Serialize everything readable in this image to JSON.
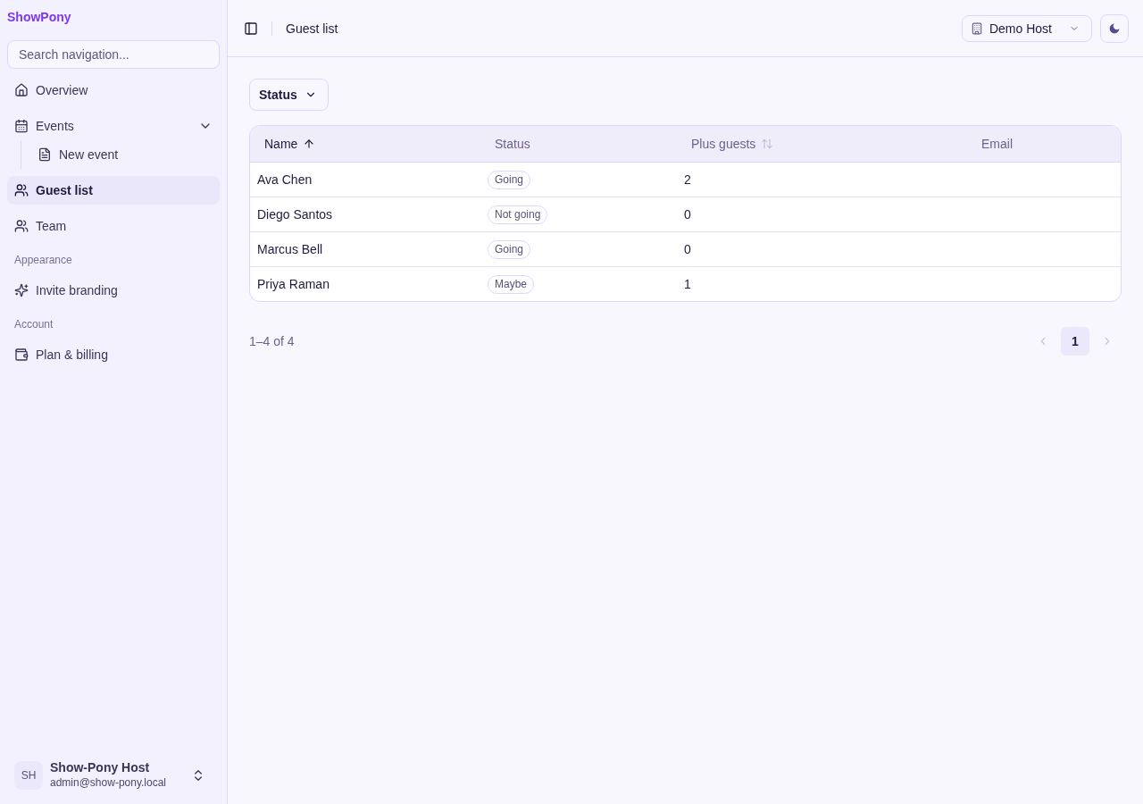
{
  "sidebar": {
    "brand": "ShowPony",
    "search": {
      "placeholder": "Search navigation..."
    },
    "groups": [
      {
        "items": [
          {
            "label": "Overview",
            "selected": false
          },
          {
            "label": "Events",
            "selected": false,
            "expanded": true,
            "children": [
              {
                "label": "New event",
                "selected": false
              }
            ]
          },
          {
            "label": "Guest list",
            "selected": true
          },
          {
            "label": "Team",
            "selected": false
          }
        ]
      },
      {
        "heading": "Appearance",
        "items": [
          {
            "label": "Invite branding",
            "selected": false
          }
        ]
      },
      {
        "heading": "Account",
        "items": [
          {
            "label": "Plan & billing",
            "selected": false
          }
        ]
      }
    ],
    "user": {
      "initials": "SH",
      "name": "Show-Pony Host",
      "email": "admin@show-pony.local"
    }
  },
  "header": {
    "title": "Guest list",
    "workspace": "Demo Host"
  },
  "filters": [
    {
      "label": "Status"
    }
  ],
  "table": {
    "columns": [
      {
        "label": "Name",
        "sortable": true,
        "sorted": true
      },
      {
        "label": "Status",
        "sortable": false,
        "sorted": false
      },
      {
        "label": "Plus guests",
        "sortable": true,
        "sorted": false
      },
      {
        "label": "Email",
        "sortable": false,
        "sorted": false
      }
    ],
    "rows": [
      {
        "name": "Ava Chen",
        "status": "Going",
        "plus_guests": "2"
      },
      {
        "name": "Diego Santos",
        "status": "Not going",
        "plus_guests": "0"
      },
      {
        "name": "Marcus Bell",
        "status": "Going",
        "plus_guests": "0"
      },
      {
        "name": "Priya Raman",
        "status": "Maybe",
        "plus_guests": "1"
      }
    ]
  },
  "pagination": {
    "range": "1–4 of 4",
    "previous_disabled": true,
    "next_disabled": true,
    "pages": [
      {
        "label": "1",
        "selected": true
      }
    ]
  }
}
